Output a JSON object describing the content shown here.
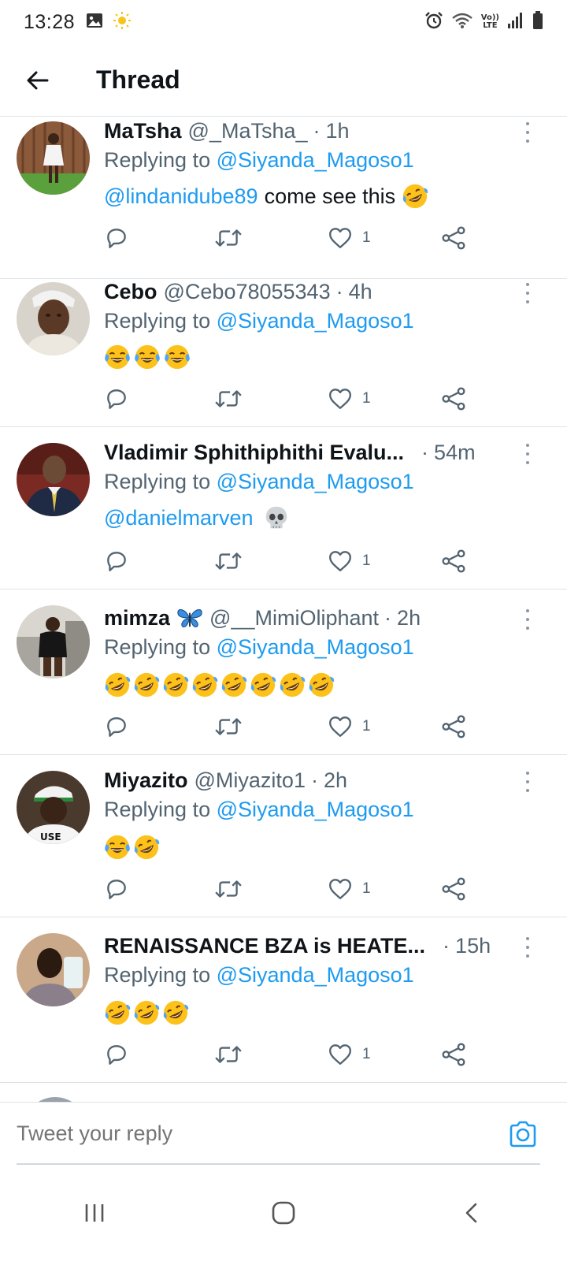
{
  "status_bar": {
    "time": "13:28",
    "icons_left": [
      "gallery-icon",
      "sun-icon"
    ],
    "icons_right": [
      "alarm-icon",
      "wifi-icon",
      "volte-icon",
      "signal-icon",
      "battery-icon"
    ],
    "volte_text_top": "Vo))",
    "volte_text_bottom": "LTE"
  },
  "header": {
    "back_icon": "arrow-left-icon",
    "title": "Thread"
  },
  "colors": {
    "accent": "#1d9bf0",
    "text_primary": "#0f1419",
    "text_secondary": "#536471",
    "divider": "#dfe3e6"
  },
  "tweets": [
    {
      "name": "MaTsha",
      "handle": "@_MaTsha_",
      "time": "1h",
      "replying_prefix": "Replying to",
      "replying_to": "@Siyanda_Magoso1",
      "mention": "@lindanidube89",
      "text": "come see this",
      "emojis": [
        "rofl"
      ],
      "likes": "1"
    },
    {
      "name": "Cebo",
      "handle": "@Cebo78055343",
      "time": "4h",
      "replying_prefix": "Replying to",
      "replying_to": "@Siyanda_Magoso1",
      "mention": "",
      "text": "",
      "emojis": [
        "joy",
        "joy",
        "joy"
      ],
      "likes": "1"
    },
    {
      "name": "Vladimir Sphithiphithi Evalu...",
      "handle": "",
      "time": "54m",
      "replying_prefix": "Replying to",
      "replying_to": "@Siyanda_Magoso1",
      "mention": "@danielmarven",
      "text": "",
      "emojis": [
        "skull"
      ],
      "likes": "1"
    },
    {
      "name": "mimza",
      "name_emoji": "butterfly",
      "handle": "@__MimiOliphant",
      "time": "2h",
      "replying_prefix": "Replying to",
      "replying_to": "@Siyanda_Magoso1",
      "mention": "",
      "text": "",
      "emojis": [
        "rofl",
        "rofl",
        "rofl",
        "rofl",
        "rofl",
        "rofl",
        "rofl",
        "rofl"
      ],
      "likes": "1"
    },
    {
      "name": "Miyazito",
      "handle": "@Miyazito1",
      "time": "2h",
      "replying_prefix": "Replying to",
      "replying_to": "@Siyanda_Magoso1",
      "mention": "",
      "text": "",
      "emojis": [
        "joy",
        "rofl"
      ],
      "likes": "1"
    },
    {
      "name": "RENAISSANCE BZA is HEATE...",
      "handle": "",
      "time": "15h",
      "replying_prefix": "Replying to",
      "replying_to": "@Siyanda_Magoso1",
      "mention": "",
      "text": "",
      "emojis": [
        "rofl",
        "rofl",
        "rofl"
      ],
      "likes": "1"
    }
  ],
  "reply_bar": {
    "placeholder": "Tweet your reply",
    "camera_icon": "camera-icon"
  },
  "nav_bar": {
    "icons": [
      "recent-apps-icon",
      "home-icon",
      "back-icon"
    ]
  }
}
